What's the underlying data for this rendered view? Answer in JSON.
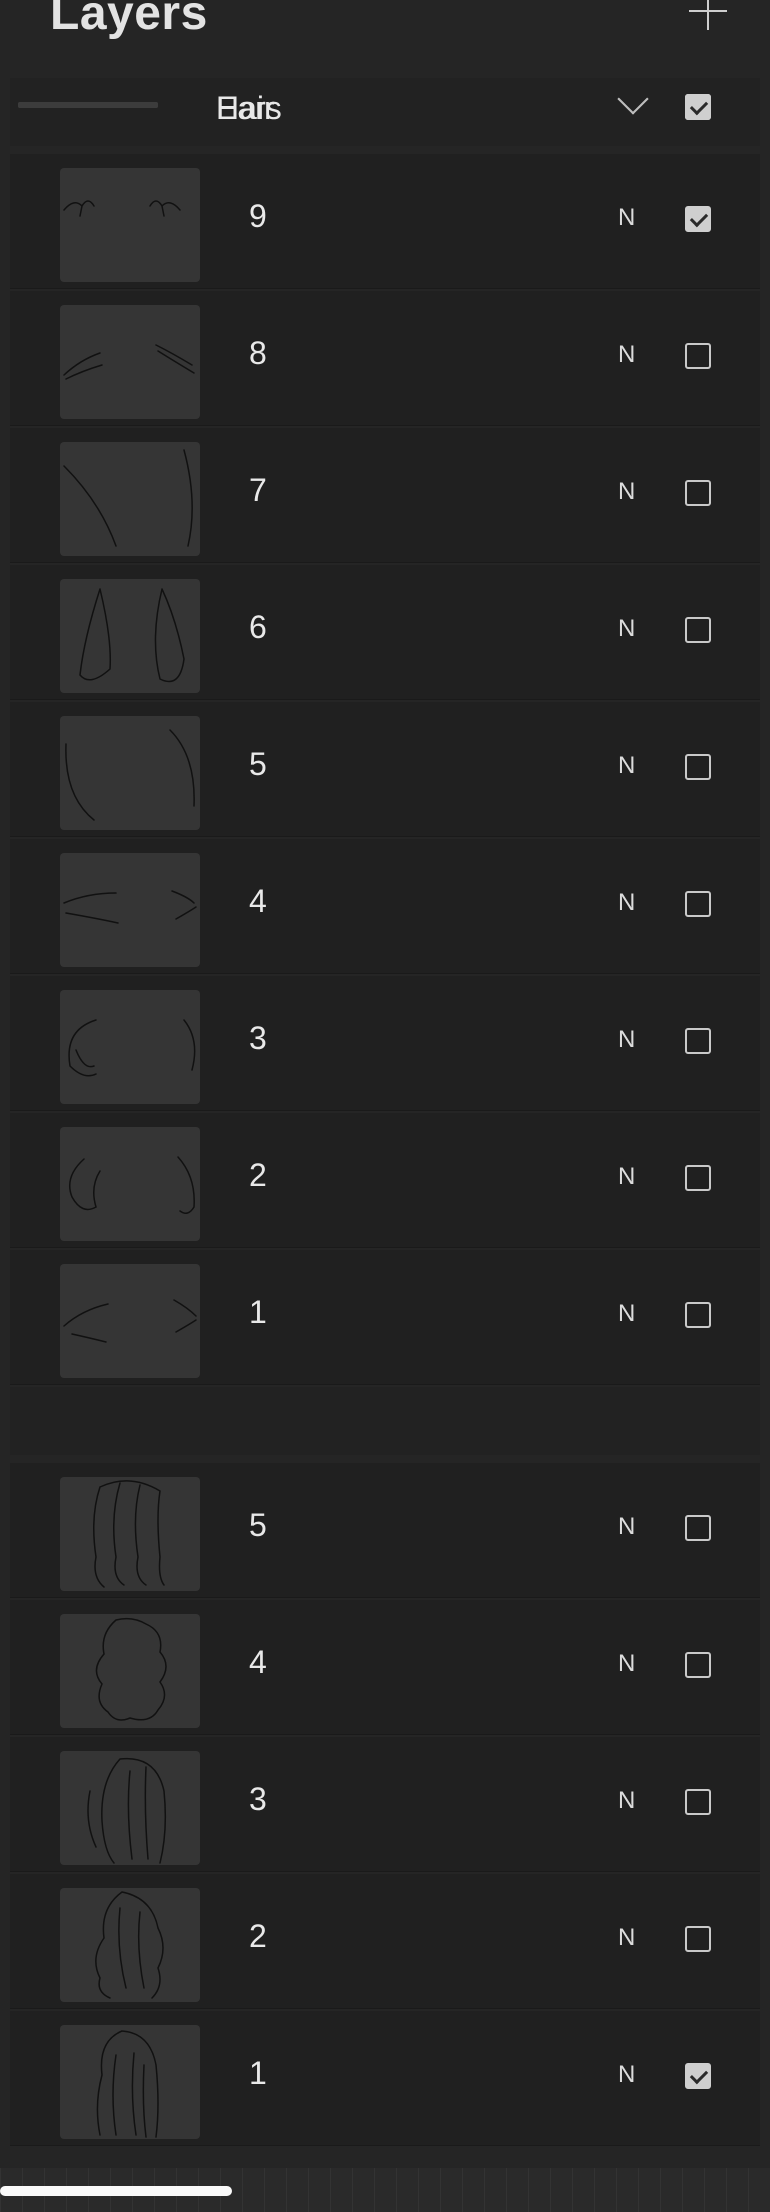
{
  "panel": {
    "title": "Layers"
  },
  "groups": [
    {
      "name": "Ears",
      "checked": true,
      "layers": [
        {
          "name": "9",
          "blend": "N",
          "checked": true,
          "icon": "ear-sketch-wings"
        },
        {
          "name": "8",
          "blend": "N",
          "checked": false,
          "icon": "ear-sketch-feathers"
        },
        {
          "name": "7",
          "blend": "N",
          "checked": false,
          "icon": "ear-sketch-long"
        },
        {
          "name": "6",
          "blend": "N",
          "checked": false,
          "icon": "ear-sketch-droopy"
        },
        {
          "name": "5",
          "blend": "N",
          "checked": false,
          "icon": "ear-sketch-elf"
        },
        {
          "name": "4",
          "blend": "N",
          "checked": false,
          "icon": "ear-sketch-flat"
        },
        {
          "name": "3",
          "blend": "N",
          "checked": false,
          "icon": "ear-sketch-round"
        },
        {
          "name": "2",
          "blend": "N",
          "checked": false,
          "icon": "ear-sketch-curl"
        },
        {
          "name": "1",
          "blend": "N",
          "checked": false,
          "icon": "ear-sketch-thin"
        }
      ]
    },
    {
      "name": "Hair",
      "checked": true,
      "layers": [
        {
          "name": "5",
          "blend": "N",
          "checked": false,
          "icon": "hair-sketch-waves"
        },
        {
          "name": "4",
          "blend": "N",
          "checked": false,
          "icon": "hair-sketch-curly"
        },
        {
          "name": "3",
          "blend": "N",
          "checked": false,
          "icon": "hair-sketch-straight"
        },
        {
          "name": "2",
          "blend": "N",
          "checked": false,
          "icon": "hair-sketch-flowing"
        },
        {
          "name": "1",
          "blend": "N",
          "checked": true,
          "icon": "hair-sketch-long"
        }
      ]
    }
  ],
  "colors": {
    "background": "#252525",
    "row": "#202020",
    "thumbnail": "#353535",
    "checkbox": "#cfcfcf"
  }
}
